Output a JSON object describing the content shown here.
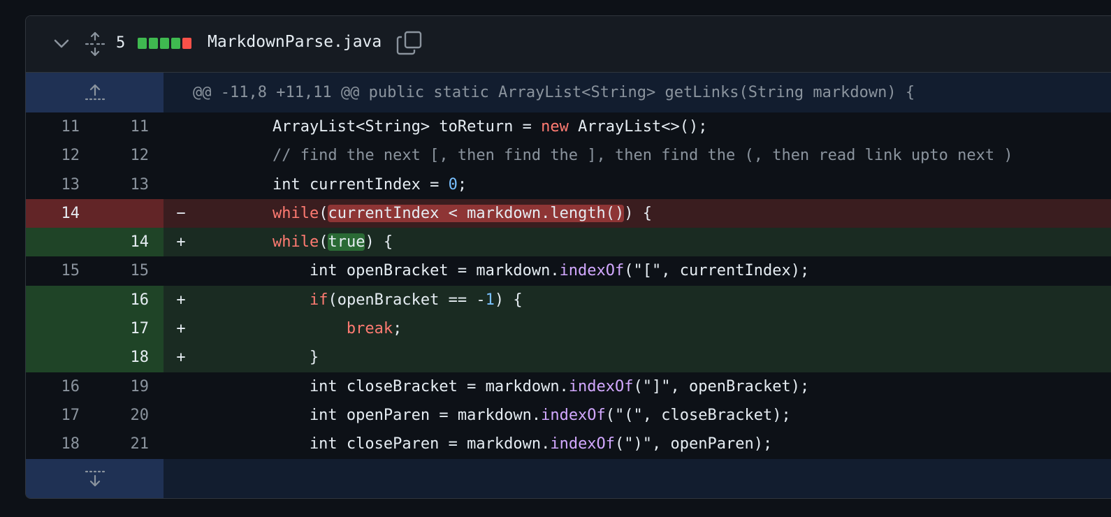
{
  "file": {
    "name": "MarkdownParse.java",
    "changes": "5",
    "diffstat": [
      "add",
      "add",
      "add",
      "add",
      "del"
    ],
    "colors": {
      "added": "#3fb950",
      "deleted": "#f85149",
      "hunk_bg": "#1f3154"
    }
  },
  "hunk_header": "@@ -11,8 +11,11 @@ public static ArrayList<String> getLinks(String markdown) {",
  "lines": [
    {
      "old": "11",
      "new": "11",
      "sign": "",
      "type": "ctx",
      "parts": [
        [
          "        ArrayList<String> toReturn = ",
          ""
        ],
        [
          "new",
          "kw"
        ],
        [
          " ArrayList<>();",
          ""
        ]
      ]
    },
    {
      "old": "12",
      "new": "12",
      "sign": "",
      "type": "ctx",
      "parts": [
        [
          "        // find the next [, then find the ], then find the (, then read link upto next )",
          "cmt"
        ]
      ]
    },
    {
      "old": "13",
      "new": "13",
      "sign": "",
      "type": "ctx",
      "parts": [
        [
          "        int currentIndex = ",
          ""
        ],
        [
          "0",
          "numlit"
        ],
        [
          ";",
          ""
        ]
      ]
    },
    {
      "old": "14",
      "new": "",
      "sign": "−",
      "type": "del",
      "parts": [
        [
          "        ",
          ""
        ],
        [
          "while",
          "kw"
        ],
        [
          "(",
          ""
        ],
        [
          "currentIndex < markdown.length()",
          "hl-del"
        ],
        [
          ") {",
          ""
        ]
      ]
    },
    {
      "old": "",
      "new": "14",
      "sign": "+",
      "type": "add",
      "parts": [
        [
          "        ",
          ""
        ],
        [
          "while",
          "kw"
        ],
        [
          "(",
          ""
        ],
        [
          "true",
          "hl-add"
        ],
        [
          ") {",
          ""
        ]
      ]
    },
    {
      "old": "15",
      "new": "15",
      "sign": "",
      "type": "ctx",
      "parts": [
        [
          "            int openBracket = markdown.",
          ""
        ],
        [
          "indexOf",
          "fn"
        ],
        [
          "(\"[\", currentIndex);",
          ""
        ]
      ]
    },
    {
      "old": "",
      "new": "16",
      "sign": "+",
      "type": "add",
      "parts": [
        [
          "            ",
          ""
        ],
        [
          "if",
          "kw"
        ],
        [
          "(openBracket == -",
          ""
        ],
        [
          "1",
          "numlit"
        ],
        [
          ") {",
          ""
        ]
      ]
    },
    {
      "old": "",
      "new": "17",
      "sign": "+",
      "type": "add",
      "parts": [
        [
          "                ",
          ""
        ],
        [
          "break",
          "kw"
        ],
        [
          ";",
          ""
        ]
      ]
    },
    {
      "old": "",
      "new": "18",
      "sign": "+",
      "type": "add",
      "parts": [
        [
          "            }",
          ""
        ]
      ]
    },
    {
      "old": "16",
      "new": "19",
      "sign": "",
      "type": "ctx",
      "parts": [
        [
          "            int closeBracket = markdown.",
          ""
        ],
        [
          "indexOf",
          "fn"
        ],
        [
          "(\"]\", openBracket);",
          ""
        ]
      ]
    },
    {
      "old": "17",
      "new": "20",
      "sign": "",
      "type": "ctx",
      "parts": [
        [
          "            int openParen = markdown.",
          ""
        ],
        [
          "indexOf",
          "fn"
        ],
        [
          "(\"(\", closeBracket);",
          ""
        ]
      ]
    },
    {
      "old": "18",
      "new": "21",
      "sign": "",
      "type": "ctx",
      "parts": [
        [
          "            int closeParen = markdown.",
          ""
        ],
        [
          "indexOf",
          "fn"
        ],
        [
          "(\")\", openParen);",
          ""
        ]
      ]
    }
  ],
  "icons": {
    "collapse": "chevron-down-icon",
    "expand_all": "unfold-icon",
    "copy": "copy-icon",
    "expand_up": "expand-up-icon",
    "expand_down": "expand-down-icon"
  }
}
